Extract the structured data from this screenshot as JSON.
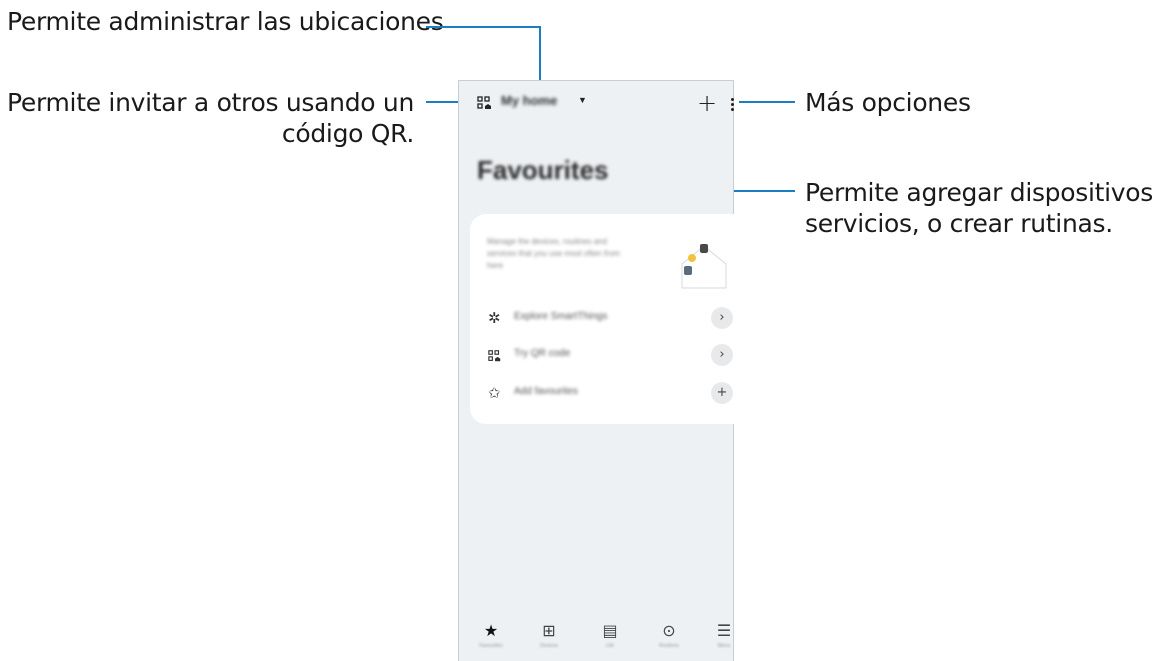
{
  "callouts": {
    "locations": "Permite administrar las ubicaciones",
    "invite_line1": "Permite invitar a otros usando un",
    "invite_line2": "código QR.",
    "more": "Más opciones",
    "add_line1": "Permite agregar dispositivos o",
    "add_line2": "servicios, o crear rutinas."
  },
  "app": {
    "location": "My home",
    "title": "Favourites",
    "card_text": "Manage the devices, routines and services that you use most often from here",
    "rows": [
      {
        "icon": "explore-icon",
        "label": "Explore SmartThings",
        "action": "chevron-right-icon"
      },
      {
        "icon": "qr-code-icon",
        "label": "Try QR code",
        "action": "chevron-right-icon"
      },
      {
        "icon": "star-icon",
        "label": "Add favourites",
        "action": "plus-icon"
      }
    ],
    "nav": [
      {
        "icon": "star-icon",
        "label": "Favourites"
      },
      {
        "icon": "devices-icon",
        "label": "Devices"
      },
      {
        "icon": "life-icon",
        "label": "Life"
      },
      {
        "icon": "routines-icon",
        "label": "Routines"
      },
      {
        "icon": "menu-icon",
        "label": "Menu"
      }
    ]
  },
  "colors": {
    "accent_line": "#1b7ec2",
    "screen_bg": "#eef1f4"
  }
}
